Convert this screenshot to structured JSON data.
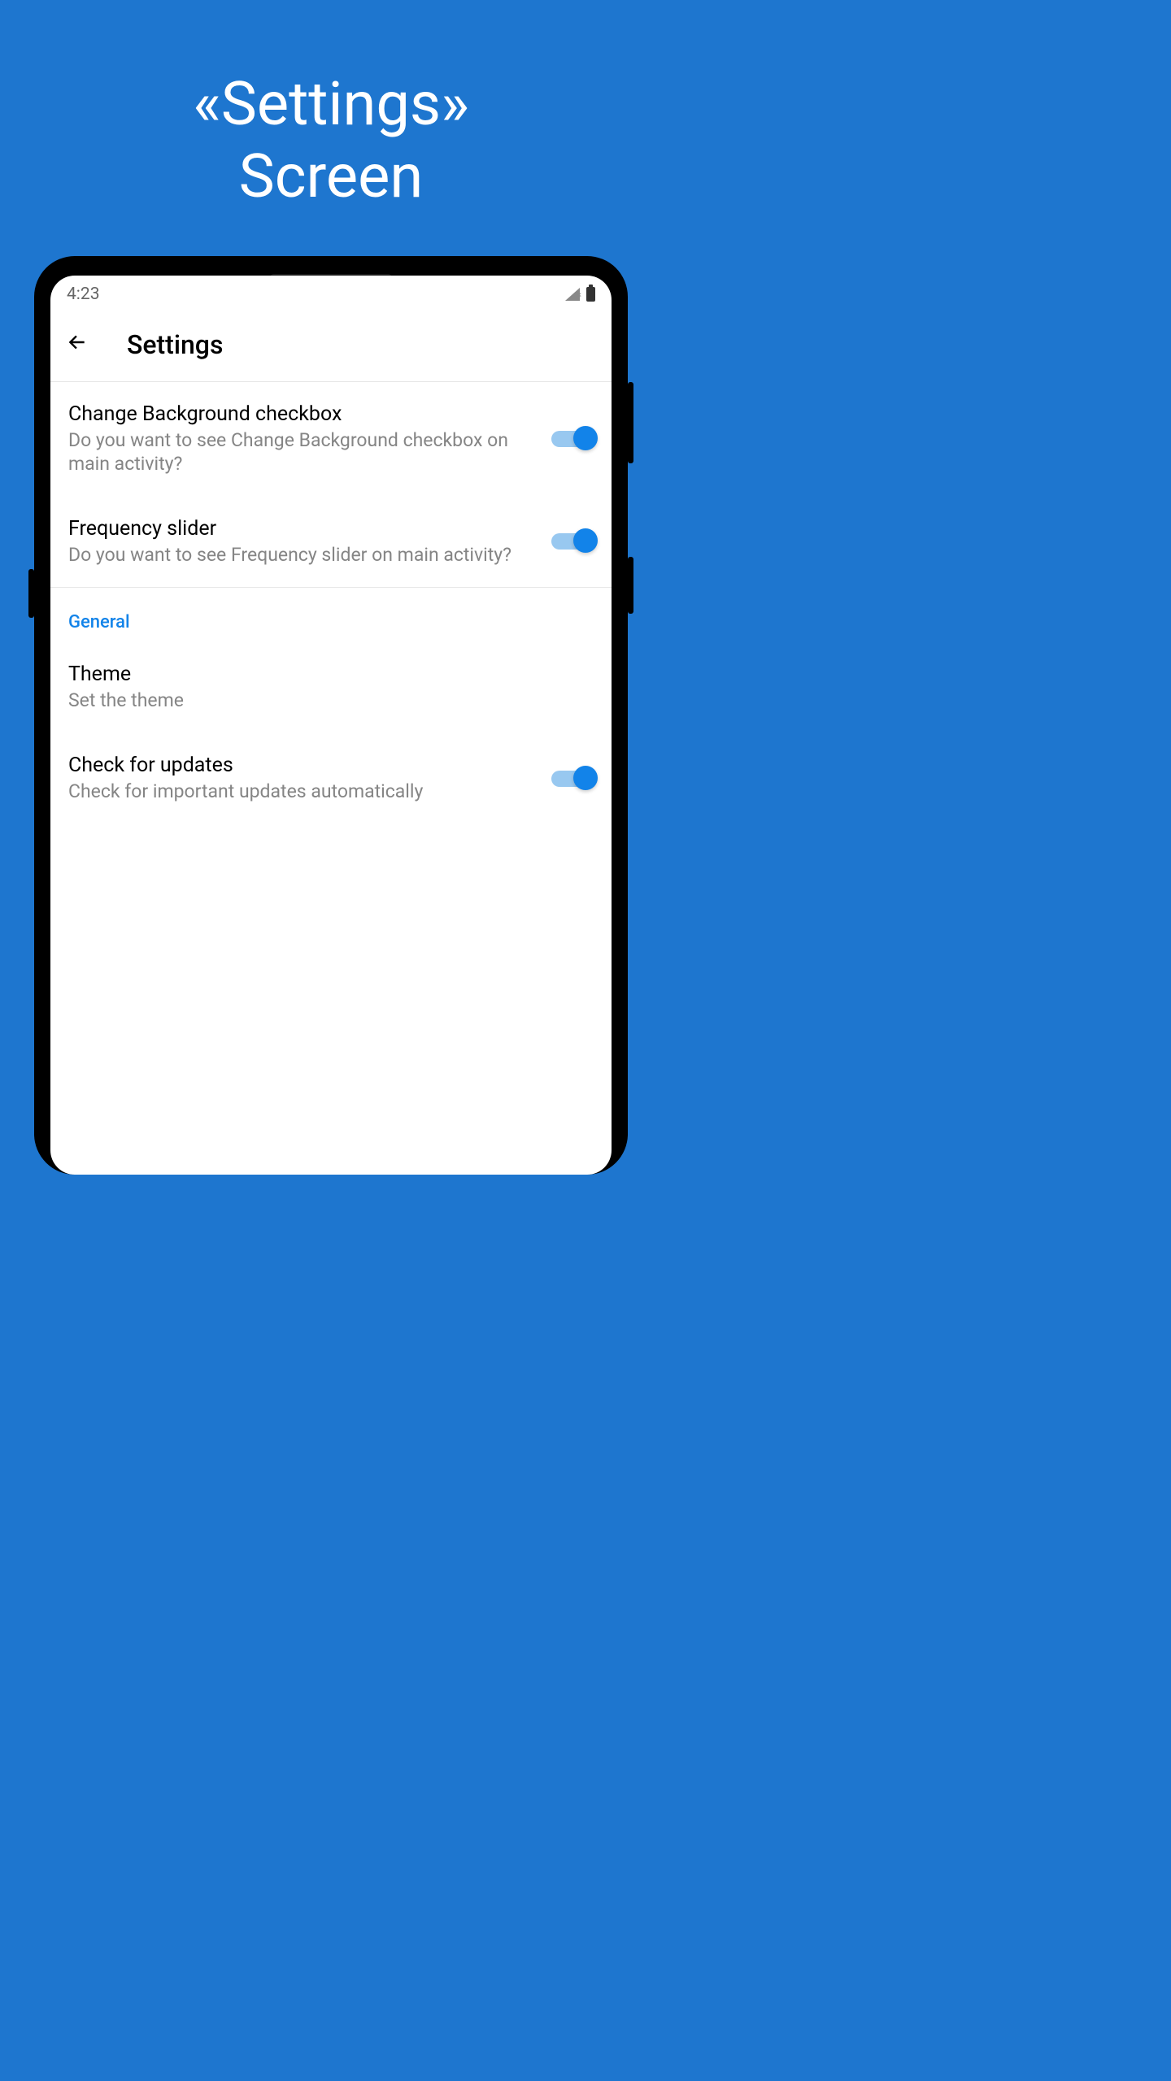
{
  "promo": {
    "line1": "«Settings»",
    "line2": "Screen"
  },
  "status": {
    "time": "4:23"
  },
  "appbar": {
    "title": "Settings"
  },
  "settings": {
    "change_bg": {
      "title": "Change Background checkbox",
      "subtitle": "Do you want to see Change Background checkbox on main activity?",
      "enabled": true
    },
    "frequency": {
      "title": "Frequency slider",
      "subtitle": "Do you want to see Frequency slider on main activity?",
      "enabled": true
    },
    "section_general": "General",
    "theme": {
      "title": "Theme",
      "subtitle": "Set the theme"
    },
    "updates": {
      "title": "Check for updates",
      "subtitle": "Check for important updates automatically",
      "enabled": true
    }
  }
}
